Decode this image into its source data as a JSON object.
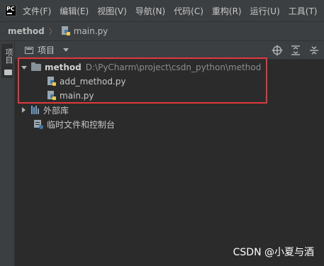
{
  "menubar": {
    "logo": "PC",
    "items": [
      "文件(F)",
      "编辑(E)",
      "视图(V)",
      "导航(N)",
      "代码(C)",
      "重构(R)",
      "运行(U)",
      "工具(T)"
    ]
  },
  "breadcrumb": {
    "root": "method",
    "file": "main.py"
  },
  "toolstrip": {
    "tab_label": "项目"
  },
  "panel": {
    "view_label": "项目",
    "icons": [
      "locate-icon",
      "expand-all-icon",
      "collapse-all-icon"
    ]
  },
  "tree": {
    "project_name": "method",
    "project_path": "D:\\PyCharm\\project\\csdn_python\\method",
    "files": [
      "add_method.py",
      "main.py"
    ],
    "external_libraries": "外部库",
    "scratches": "临时文件和控制台"
  },
  "colors": {
    "highlight": "#e0383c",
    "background": "#2b2b2b",
    "toolbar": "#3c3f41"
  },
  "watermark": "CSDN @小夏与酒"
}
